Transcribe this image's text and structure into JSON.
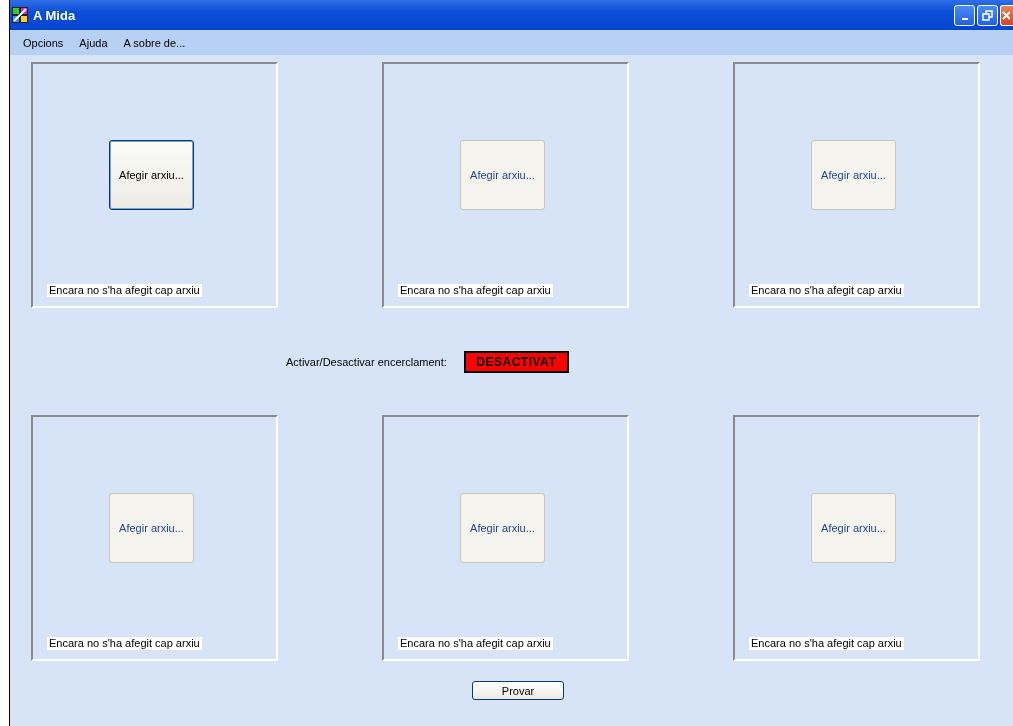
{
  "window": {
    "title": "A Mida"
  },
  "menu": [
    "Opcions",
    "Ajuda",
    "A sobre de..."
  ],
  "slots_top": [
    {
      "button": "Afegir arxiu...",
      "disabled": false,
      "status": "Encara no s'ha afegit cap arxiu"
    },
    {
      "button": "Afegir arxiu...",
      "disabled": true,
      "status": "Encara no s'ha afegit cap arxiu"
    },
    {
      "button": "Afegir arxiu...",
      "disabled": true,
      "status": "Encara no s'ha afegit cap arxiu"
    }
  ],
  "toggle": {
    "label": "Activar/Desactivar encerclament:",
    "button": "DESACTIVAT",
    "on": false
  },
  "slots_bottom": [
    {
      "button": "Afegir arxiu...",
      "disabled": true,
      "status": "Encara no s'ha afegit cap arxiu"
    },
    {
      "button": "Afegir arxiu...",
      "disabled": true,
      "status": "Encara no s'ha afegit cap arxiu"
    },
    {
      "button": "Afegir arxiu...",
      "disabled": true,
      "status": "Encara no s'ha afegit cap arxiu"
    }
  ],
  "buttons": [
    "Provar"
  ]
}
